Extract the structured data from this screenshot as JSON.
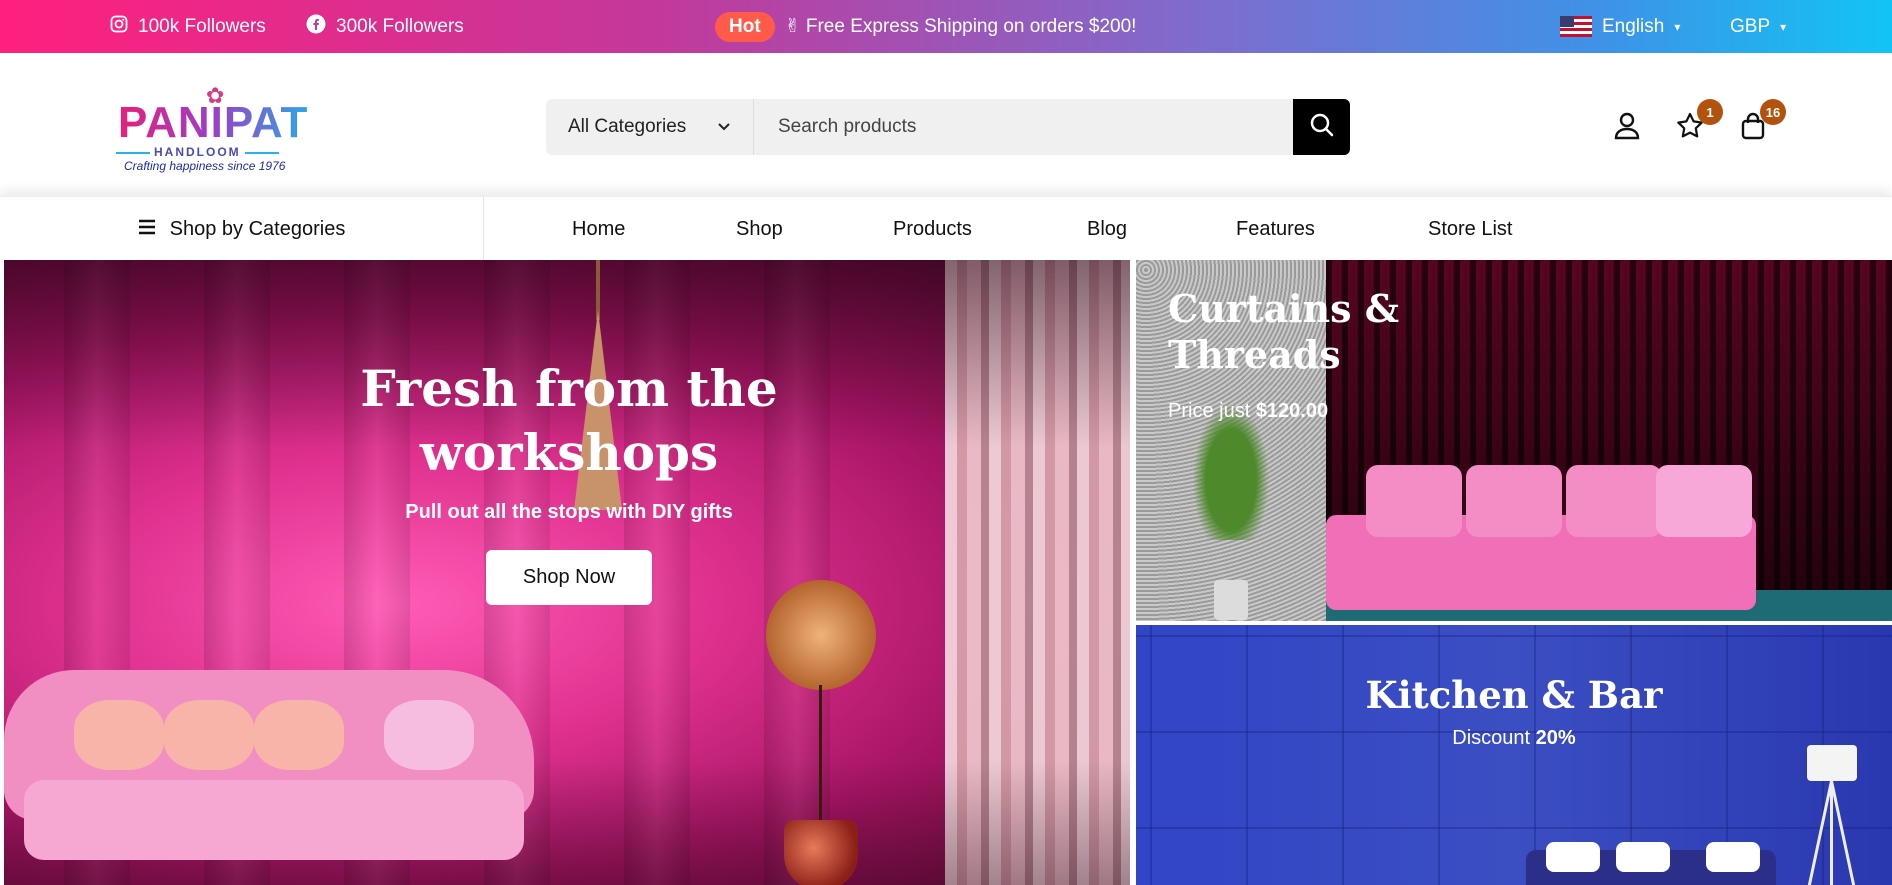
{
  "topbar": {
    "instagram_text": "100k Followers",
    "facebook_text": "300k Followers",
    "hot_badge": "Hot",
    "promo_text": "✌ Free Express Shipping on orders $200!",
    "language": "English",
    "currency": "GBP"
  },
  "header": {
    "logo": {
      "name": "PANIPAT",
      "sub": "HANDLOOM",
      "tagline": "Crafting happiness since 1976"
    },
    "search": {
      "category_label": "All Categories",
      "placeholder": "Search products"
    },
    "wishlist_count": "1",
    "cart_count": "16"
  },
  "nav": {
    "categories_label": "Shop by Categories",
    "links": [
      "Home",
      "Shop",
      "Products",
      "Blog",
      "Features",
      "Store List"
    ]
  },
  "hero": {
    "title": "Fresh from the workshops",
    "subtitle": "Pull out all the stops with DIY gifts",
    "button": "Shop Now"
  },
  "banner_curtains": {
    "title": "Curtains & Threads",
    "price_prefix": "Price just",
    "price": "$120.00"
  },
  "banner_kitchen": {
    "title": "Kitchen & Bar",
    "sub_prefix": "Discount",
    "discount": "20%"
  },
  "colors": {
    "topbar_start": "#ff1f7e",
    "topbar_end": "#12c4f5",
    "hot_badge": "#ff5a4a",
    "badge": "#b3520c"
  }
}
